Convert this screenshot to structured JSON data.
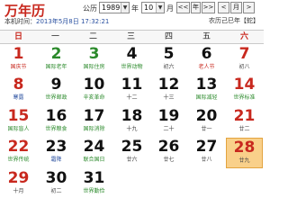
{
  "header": {
    "app_title": "万年历",
    "time_prefix": "本机时间：",
    "time_value": "2013年5月8日 17:32:21",
    "calendar_label": "公历",
    "year_value": "1989",
    "year_suffix": "年",
    "month_value": "10",
    "month_suffix": "月",
    "nav_prev_year": "<<",
    "nav_year_label": "年",
    "nav_next_year": ">>",
    "nav_prev_month": "<",
    "nav_month_label": "月",
    "nav_next_month": ">",
    "lunar_year": "农历己巳年【蛇】"
  },
  "weekdays": [
    "日",
    "一",
    "二",
    "三",
    "四",
    "五",
    "六"
  ],
  "days": [
    {
      "n": "1",
      "l": "国庆节",
      "c": "red",
      "lc": "red"
    },
    {
      "n": "2",
      "l": "国际老年",
      "c": "green",
      "lc": "green"
    },
    {
      "n": "3",
      "l": "国际住房",
      "c": "green",
      "lc": "green"
    },
    {
      "n": "4",
      "l": "世界动物",
      "c": "",
      "lc": "green"
    },
    {
      "n": "5",
      "l": "初六",
      "c": "",
      "lc": ""
    },
    {
      "n": "6",
      "l": "老人节",
      "c": "",
      "lc": "red"
    },
    {
      "n": "7",
      "l": "初八",
      "c": "red",
      "lc": ""
    },
    {
      "n": "8",
      "l": "寒露",
      "c": "red",
      "lc": "blue"
    },
    {
      "n": "9",
      "l": "世界邮政",
      "c": "",
      "lc": "green"
    },
    {
      "n": "10",
      "l": "辛亥革命",
      "c": "",
      "lc": "green"
    },
    {
      "n": "11",
      "l": "十二",
      "c": "",
      "lc": ""
    },
    {
      "n": "12",
      "l": "十三",
      "c": "",
      "lc": ""
    },
    {
      "n": "13",
      "l": "国际减轻",
      "c": "",
      "lc": "green"
    },
    {
      "n": "14",
      "l": "世界标准",
      "c": "red",
      "lc": "green"
    },
    {
      "n": "15",
      "l": "国际盲人",
      "c": "red",
      "lc": "green"
    },
    {
      "n": "16",
      "l": "世界粮食",
      "c": "",
      "lc": "green"
    },
    {
      "n": "17",
      "l": "国际消除",
      "c": "",
      "lc": "green"
    },
    {
      "n": "18",
      "l": "十九",
      "c": "",
      "lc": ""
    },
    {
      "n": "19",
      "l": "二十",
      "c": "",
      "lc": ""
    },
    {
      "n": "20",
      "l": "廿一",
      "c": "",
      "lc": ""
    },
    {
      "n": "21",
      "l": "廿二",
      "c": "red",
      "lc": ""
    },
    {
      "n": "22",
      "l": "世界传统",
      "c": "red",
      "lc": "green"
    },
    {
      "n": "23",
      "l": "霜降",
      "c": "",
      "lc": "blue"
    },
    {
      "n": "24",
      "l": "联合国日",
      "c": "",
      "lc": "green"
    },
    {
      "n": "25",
      "l": "廿六",
      "c": "",
      "lc": ""
    },
    {
      "n": "26",
      "l": "廿七",
      "c": "",
      "lc": ""
    },
    {
      "n": "27",
      "l": "廿八",
      "c": "",
      "lc": ""
    },
    {
      "n": "28",
      "l": "廿九",
      "c": "red",
      "lc": "",
      "today": true
    },
    {
      "n": "29",
      "l": "十月",
      "c": "red",
      "lc": ""
    },
    {
      "n": "30",
      "l": "初二",
      "c": "",
      "lc": ""
    },
    {
      "n": "31",
      "l": "世界勤俭",
      "c": "",
      "lc": "green"
    }
  ],
  "colors": {
    "accent_red": "#c8281e",
    "festival_green": "#2b8a2b",
    "solar_term_blue": "#2a50a0",
    "today_highlight": "#f9d08a"
  }
}
